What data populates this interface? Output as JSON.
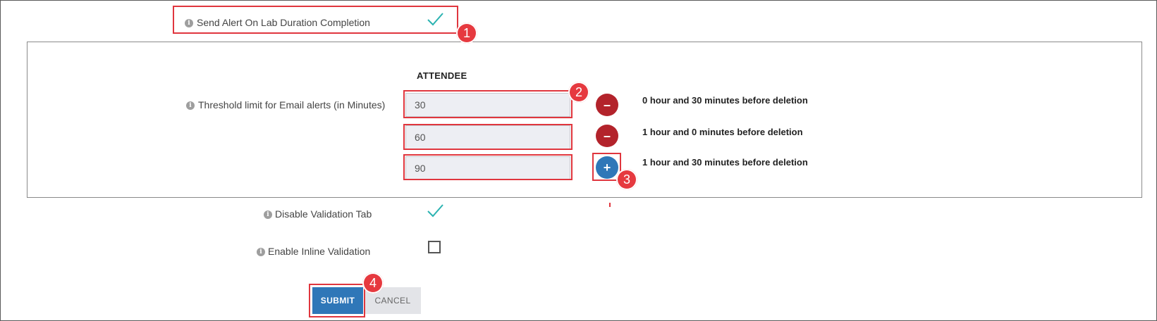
{
  "alert_row": {
    "label": "Send Alert On Lab Duration Completion",
    "checked": true
  },
  "threshold": {
    "column_header": "ATTENDEE",
    "label": "Threshold limit for Email alerts (in Minutes)",
    "entries": [
      {
        "value": "30",
        "description": "0 hour and 30 minutes before deletion",
        "action": "remove"
      },
      {
        "value": "60",
        "description": "1 hour and 0 minutes before deletion",
        "action": "remove"
      },
      {
        "value": "90",
        "description": "1 hour and 30 minutes before deletion",
        "action": "add"
      }
    ]
  },
  "disable_validation": {
    "label": "Disable Validation Tab",
    "checked": true
  },
  "inline_validation": {
    "label": "Enable Inline Validation",
    "checked": false
  },
  "actions": {
    "submit_label": "SUBMIT",
    "cancel_label": "CANCEL"
  },
  "annotations": {
    "badge_1": "1",
    "badge_2": "2",
    "badge_3": "3",
    "badge_4": "4"
  },
  "icons": {
    "remove_glyph": "–",
    "add_glyph": "+",
    "info_glyph": "i"
  },
  "colors": {
    "accent": "#2f77b8",
    "danger": "#b3232b",
    "check": "#2bb3b1",
    "highlight": "#e0363e"
  }
}
